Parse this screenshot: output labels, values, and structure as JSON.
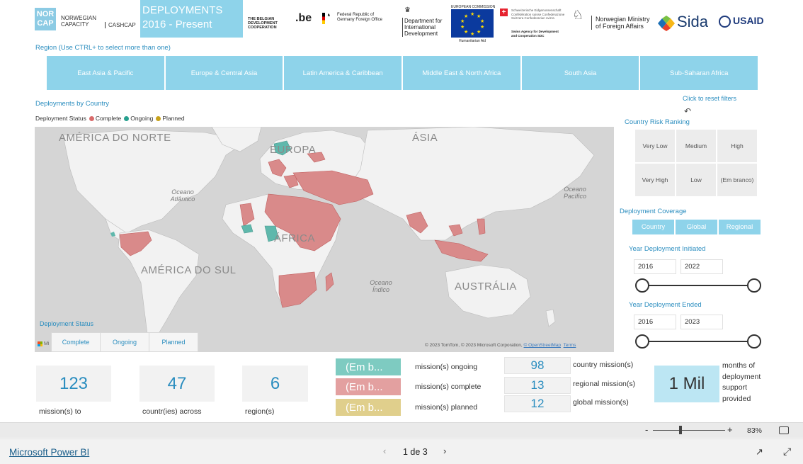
{
  "header": {
    "norcap_box": "NOR CAP",
    "norcap_text_1": "NORWEGIAN",
    "norcap_text_2": "CAPACITY",
    "cashcap": "CASHCAP",
    "banner_line1": "DEPLOYMENTS",
    "banner_line2": "2016 - Present",
    "logos": {
      "belgian": "THE BELGIAN DEVELOPMENT COOPERATION",
      "be": ".be",
      "germany": "Federal Republic of Germany Foreign Office",
      "dfid": "Department for International Development",
      "eu_top": "EUROPEAN COMMISSION",
      "eu_bottom": "Humanitarian Aid",
      "swiss": "Schweizerische Eidgenossenschaft Confédération suisse Confederazione Svizzera Confederaziun svizra",
      "swiss_sub": "Swiss Agency for Development and Cooperation SDC",
      "norway": "Norwegian Ministry of Foreign Affairs",
      "sida": "Sida",
      "usaid": "USAID"
    }
  },
  "region_filter": {
    "label": "Region (Use CTRL+ to select more than one)",
    "options": [
      "East Asia & Pacific",
      "Europe & Central Asia",
      "Latin America & Caribbean",
      "Middle East & North Africa",
      "South Asia",
      "Sub-Saharan Africa"
    ]
  },
  "map": {
    "title": "Deployments by Country",
    "legend_title": "Deployment Status",
    "legend": [
      {
        "label": "Complete",
        "color": "#d96b6b"
      },
      {
        "label": "Ongoing",
        "color": "#27a08f"
      },
      {
        "label": "Planned",
        "color": "#c7a11a"
      }
    ],
    "labels": {
      "north_america": "AMÉRICA DO NORTE",
      "south_america": "AMÉRICA DO SUL",
      "europe": "EUROPA",
      "asia": "ÁSIA",
      "africa": "ÁFRICA",
      "australia": "AUSTRÁLIA",
      "atlantic": "Oceano Atlântico",
      "pacific": "Oceano Pacífico",
      "indian": "Oceano Índico"
    },
    "copyright": "© 2023 TomTom, © 2023 Microsoft Corporation, ",
    "osm": "© OpenStreetMap",
    "terms": "Terms",
    "ms_logo": "Mi",
    "colors": {
      "land": "#f2f2f2",
      "ocean": "#d5d5d5",
      "complete": "#d98a8a",
      "ongoing": "#5fb8ac"
    }
  },
  "deployment_status_filter": {
    "label": "Deployment Status",
    "options": [
      "Complete",
      "Ongoing",
      "Planned"
    ]
  },
  "right_panel": {
    "reset_label": "Click to reset filters",
    "risk_label": "Country Risk Ranking",
    "risk_options": [
      "Very Low",
      "Medium",
      "High",
      "Very High",
      "Low",
      "(Em branco)"
    ],
    "coverage_label": "Deployment Coverage",
    "coverage_options": [
      "Country",
      "Global",
      "Regional"
    ],
    "initiated_label": "Year Deployment Initiated",
    "initiated_from": "2016",
    "initiated_to": "2022",
    "ended_label": "Year Deployment Ended",
    "ended_from": "2016",
    "ended_to": "2023"
  },
  "kpis": {
    "missions": {
      "value": "123",
      "caption": "mission(s) to"
    },
    "countries": {
      "value": "47",
      "caption": "countr(ies) across"
    },
    "regions": {
      "value": "6",
      "caption": "region(s)"
    },
    "status": [
      {
        "value": "(Em b...",
        "caption": "mission(s) ongoing",
        "color": "#7ecbc1"
      },
      {
        "value": "(Em b...",
        "caption": "mission(s) complete",
        "color": "#e3a0a0"
      },
      {
        "value": "(Em b...",
        "caption": "mission(s) planned",
        "color": "#e0cf8c"
      }
    ],
    "coverage_counts": [
      {
        "value": "98",
        "caption": "country mission(s)"
      },
      {
        "value": "13",
        "caption": "regional mission(s)"
      },
      {
        "value": "12",
        "caption": "global mission(s)"
      }
    ],
    "months": {
      "value": "1 Mil",
      "caption": "months of deployment support provided"
    }
  },
  "zoom": {
    "minus": "-",
    "plus": "+",
    "percent": "83%"
  },
  "footer": {
    "link": "Microsoft Power BI",
    "page": "1 de 3",
    "prev": "‹",
    "next": "›"
  }
}
